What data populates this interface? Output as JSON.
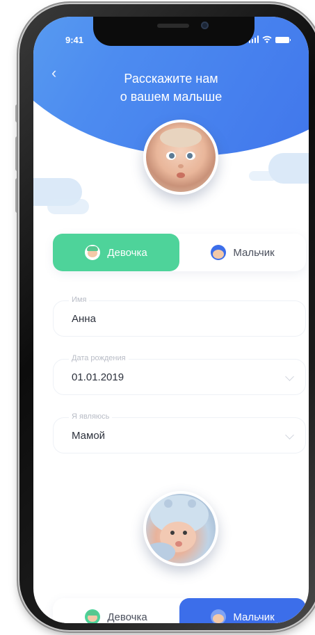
{
  "status_bar": {
    "time": "9:41"
  },
  "header": {
    "title_line1": "Расскажите нам",
    "title_line2": "о вашем малыше",
    "back_icon": "chevron-left-icon"
  },
  "gender_toggle": {
    "girl_label": "Девочка",
    "boy_label": "Мальчик",
    "selected": "girl",
    "active_color": "#4ed39a"
  },
  "form": {
    "name": {
      "label": "Имя",
      "value": "Анна"
    },
    "birth_date": {
      "label": "Дата рождения",
      "value": "01.01.2019"
    },
    "role": {
      "label": "Я являюсь",
      "value": "Мамой"
    }
  },
  "gender_toggle_bottom": {
    "girl_label": "Девочка",
    "boy_label": "Мальчик",
    "selected": "boy",
    "active_color": "#3c6eea"
  },
  "colors": {
    "header_blue": "#4d8cf0",
    "accent_green": "#4ed39a",
    "accent_blue": "#3c6eea"
  }
}
